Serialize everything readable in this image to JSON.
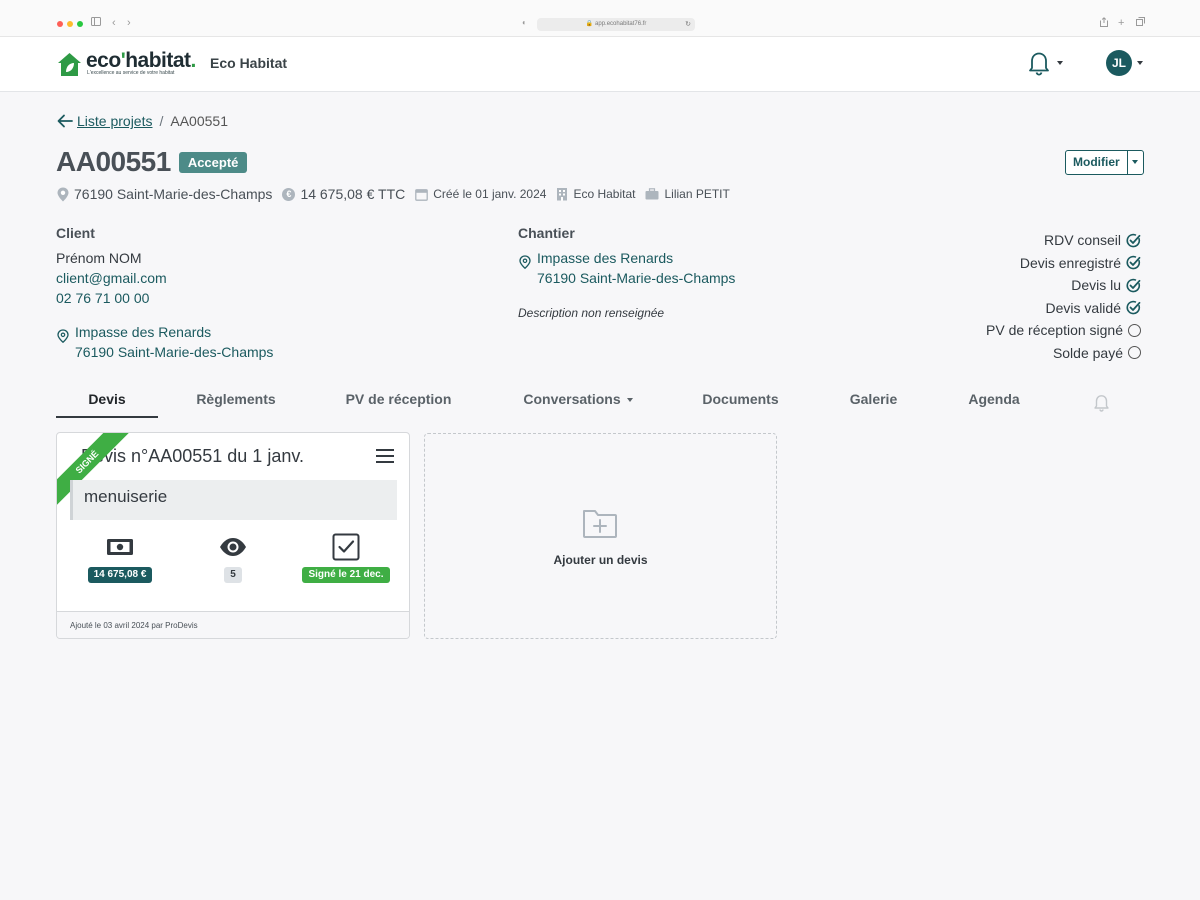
{
  "browser": {
    "url": "app.ecohabitat76.fr"
  },
  "header": {
    "logo_word_1": "eco",
    "logo_word_2": "habitat",
    "logo_tagline": "L'excellence au service de votre habitat",
    "org_name": "Eco Habitat",
    "user_initials": "JL",
    "icons": [
      "bell-icon",
      "chevron-down-icon"
    ]
  },
  "breadcrumb": {
    "back_label": " Liste projets",
    "separator": "/",
    "current": "AA00551"
  },
  "project": {
    "code": "AA00551",
    "status": "Accepté",
    "modify_label": "Modifier",
    "location": "76190 Saint-Marie-des-Champs",
    "amount": "14 675,08 € TTC",
    "created": "Créé le 01 janv. 2024",
    "company": "Eco Habitat",
    "contact": "Lilian PETIT"
  },
  "client": {
    "heading": "Client",
    "name": "Prénom NOM",
    "email": "client@gmail.com",
    "phone": "02 76 71 00 00",
    "address_line1": "Impasse des Renards",
    "address_line2": "76190 Saint-Marie-des-Champs"
  },
  "site": {
    "heading": "Chantier",
    "address_line1": "Impasse des Renards",
    "address_line2": "76190 Saint-Marie-des-Champs",
    "description": "Description non renseignée"
  },
  "checklist": [
    {
      "label": "RDV conseil",
      "done": true
    },
    {
      "label": "Devis enregistré",
      "done": true
    },
    {
      "label": "Devis lu",
      "done": true
    },
    {
      "label": "Devis validé",
      "done": true
    },
    {
      "label": "PV de réception signé",
      "done": false
    },
    {
      "label": "Solde payé",
      "done": false
    }
  ],
  "tabs": [
    {
      "label": "Devis",
      "active": true
    },
    {
      "label": "Règlements"
    },
    {
      "label": "PV de réception"
    },
    {
      "label": "Conversations"
    },
    {
      "label": "Documents"
    },
    {
      "label": "Galerie"
    },
    {
      "label": "Agenda"
    }
  ],
  "quote": {
    "ribbon": "SIGNÉ",
    "title": "Devis n°AA00551 du 1 janv.",
    "subject": "menuiserie",
    "amount_badge": "14 675,08 €",
    "views_badge": "5",
    "signed_badge": "Signé le 21 dec.",
    "footer": "Ajouté le 03 avril 2024 par ProDevis"
  },
  "add_quote": {
    "label": "Ajouter un devis"
  },
  "colors": {
    "brand_teal": "#1b5a5f",
    "status_badge": "#4d8b88",
    "signed_green": "#3fae44",
    "logo_green": "#2e9a45"
  }
}
